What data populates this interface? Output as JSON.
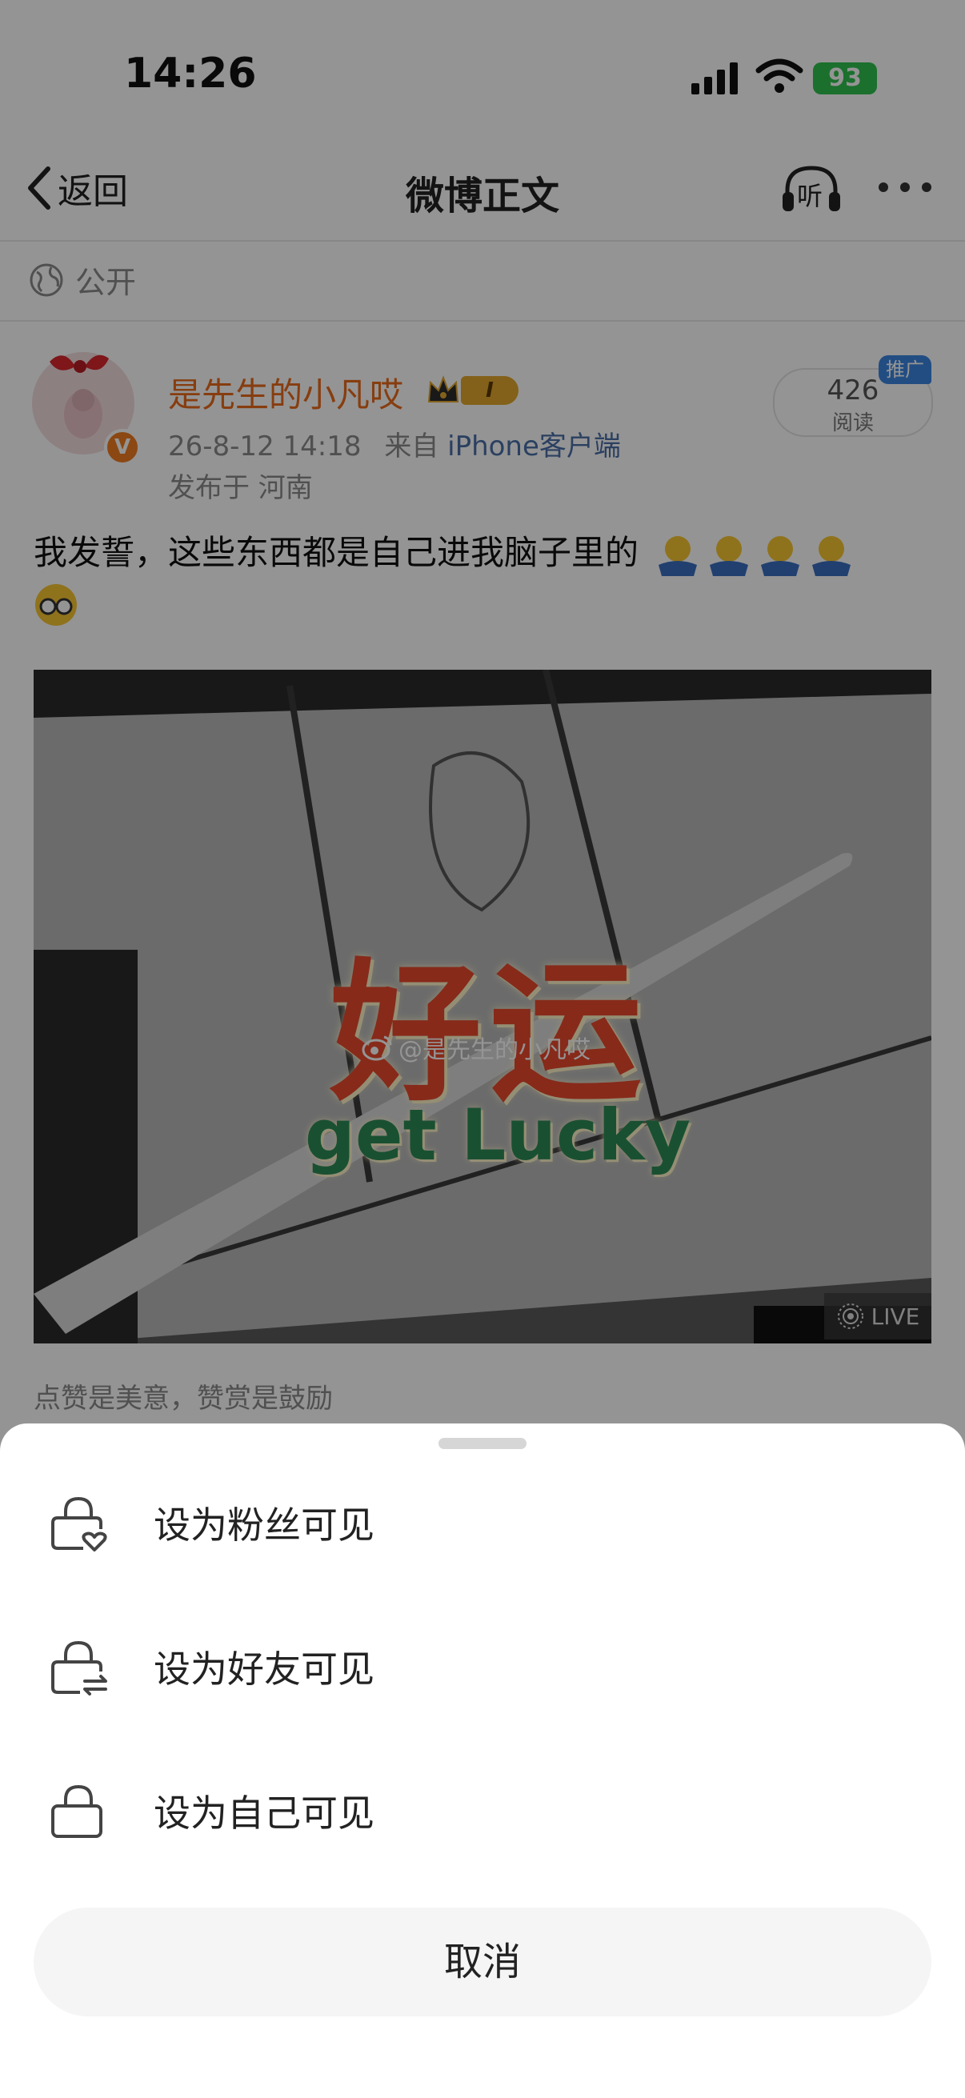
{
  "status_bar": {
    "time": "14:26",
    "battery": "93"
  },
  "nav": {
    "back_label": "返回",
    "title": "微博正文",
    "listen_label": "听"
  },
  "visibility": {
    "label": "公开"
  },
  "post": {
    "username": "是先生的小凡哎",
    "vip_level": "I",
    "timestamp": "26-8-12 14:18",
    "source_prefix": "来自",
    "source": "iPhone客户端",
    "location": "发布于 河南",
    "reads_count": "426",
    "reads_label": "阅读",
    "promo_tag": "推广",
    "text": "我发誓，这些东西都是自己进我脑子里的",
    "image": {
      "title": "好运",
      "subtitle": "get Lucky",
      "watermark": "@是先生的小凡哎",
      "live_label": "LIVE"
    },
    "reward_hint": "点赞是美意，赞赏是鼓励"
  },
  "sheet": {
    "options": [
      {
        "label": "设为粉丝可见",
        "icon": "lock-heart-icon"
      },
      {
        "label": "设为好友可见",
        "icon": "lock-swap-icon"
      },
      {
        "label": "设为自己可见",
        "icon": "lock-icon"
      }
    ],
    "cancel_label": "取消"
  },
  "colors": {
    "username": "#e86a1b",
    "link": "#4a6ea8",
    "battery": "#2fc24e",
    "promo": "#3b86e0",
    "image_title": "#e8492d",
    "image_subtitle": "#2e8b57"
  }
}
